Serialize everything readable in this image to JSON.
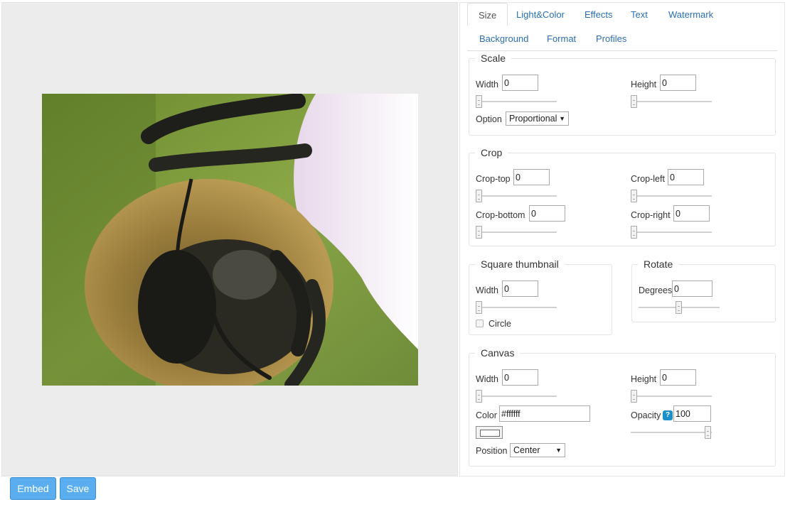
{
  "tabs": [
    "Size",
    "Light&Color",
    "Effects",
    "Text",
    "Watermark",
    "Background",
    "Format",
    "Profiles"
  ],
  "scale": {
    "title": "Scale",
    "width_label": "Width",
    "width_value": "0",
    "height_label": "Height",
    "height_value": "0",
    "option_label": "Option",
    "option_value": "Proportional"
  },
  "crop": {
    "title": "Crop",
    "top_label": "Crop-top",
    "top_value": "0",
    "left_label": "Crop-left",
    "left_value": "0",
    "bottom_label": "Crop-bottom",
    "bottom_value": "0",
    "right_label": "Crop-right",
    "right_value": "0"
  },
  "square_thumbnail": {
    "title": "Square thumbnail",
    "width_label": "Width",
    "width_value": "0",
    "circle_label": "Circle",
    "circle_checked": false
  },
  "rotate": {
    "title": "Rotate",
    "degrees_label": "Degrees",
    "degrees_value": "0"
  },
  "canvas": {
    "title": "Canvas",
    "width_label": "Width",
    "width_value": "0",
    "height_label": "Height",
    "height_value": "0",
    "color_label": "Color",
    "color_value": "#ffffff",
    "opacity_label": "Opacity",
    "opacity_value": "100",
    "position_label": "Position",
    "position_value": "Center"
  },
  "buttons": {
    "embed": "Embed",
    "save": "Save"
  },
  "colors": {
    "link": "#2a6fb3",
    "button": "#5aaef0",
    "preview_bg": "#ececec"
  },
  "icons": {
    "help": "question-mark-icon",
    "dropdown": "dropdown-arrow-icon"
  }
}
